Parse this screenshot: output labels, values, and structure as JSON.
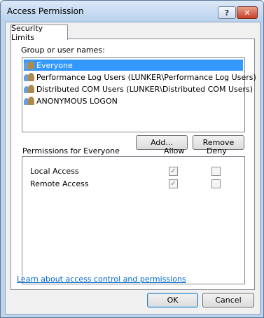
{
  "window": {
    "title": "Access Permission",
    "help_label": "?",
    "close_label": "✕"
  },
  "tab": {
    "label": "Security Limits"
  },
  "group": {
    "label": "Group or user names:",
    "items": [
      {
        "label": "Everyone",
        "selected": true
      },
      {
        "label": "Performance Log Users (LUNKER\\Performance Log Users)",
        "selected": false
      },
      {
        "label": "Distributed COM Users (LUNKER\\Distributed COM Users)",
        "selected": false
      },
      {
        "label": "ANONYMOUS LOGON",
        "selected": false
      }
    ],
    "add_label": "Add...",
    "remove_label": "Remove"
  },
  "permissions": {
    "label": "Permissions for Everyone",
    "allow_header": "Allow",
    "deny_header": "Deny",
    "rows": [
      {
        "label": "Local Access",
        "allow": true,
        "deny": false
      },
      {
        "label": "Remote Access",
        "allow": true,
        "deny": false
      }
    ]
  },
  "link": {
    "label": "Learn about access control and permissions"
  },
  "footer": {
    "ok_label": "OK",
    "cancel_label": "Cancel"
  }
}
